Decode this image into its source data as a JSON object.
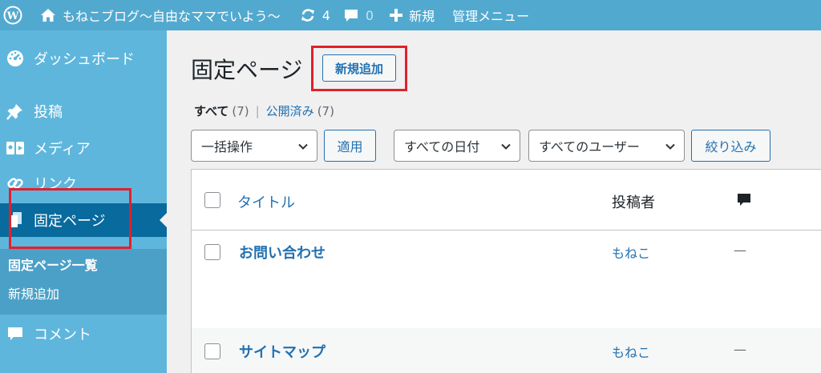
{
  "adminbar": {
    "site_title": "もねこブログ〜自由なママでいよう〜",
    "updates_count": "4",
    "comments_count": "0",
    "new_label": "新規",
    "manage_label": "管理メニュー"
  },
  "sidebar": {
    "items": [
      {
        "label": "ダッシュボード",
        "icon": "dashboard-icon"
      },
      {
        "label": "投稿",
        "icon": "pin-icon"
      },
      {
        "label": "メディア",
        "icon": "media-icon"
      },
      {
        "label": "リンク",
        "icon": "link-icon"
      },
      {
        "label": "固定ページ",
        "icon": "page-icon"
      },
      {
        "label": "コメント",
        "icon": "comment-icon"
      }
    ],
    "submenu": [
      "固定ページ一覧",
      "新規追加"
    ]
  },
  "main": {
    "title": "固定ページ",
    "add_new_label": "新規追加",
    "filters": {
      "all_label": "すべて",
      "all_count": "(7)",
      "separator": "|",
      "published_label": "公開済み",
      "published_count": "(7)"
    },
    "bulk_action": "一括操作",
    "apply_label": "適用",
    "date_filter": "すべての日付",
    "user_filter": "すべてのユーザー",
    "filter_label": "絞り込み",
    "table": {
      "columns": {
        "title": "タイトル",
        "author": "投稿者"
      },
      "rows": [
        {
          "title": "お問い合わせ",
          "author": "もねこ",
          "comments": "—"
        },
        {
          "title": "サイトマップ",
          "author": "もねこ",
          "comments": "—"
        }
      ]
    }
  },
  "colors": {
    "adminbar": "#52a9cf",
    "sidebar": "#5fb6dc",
    "current": "#086a9d",
    "link": "#2271b1",
    "highlight": "#e2202c"
  }
}
